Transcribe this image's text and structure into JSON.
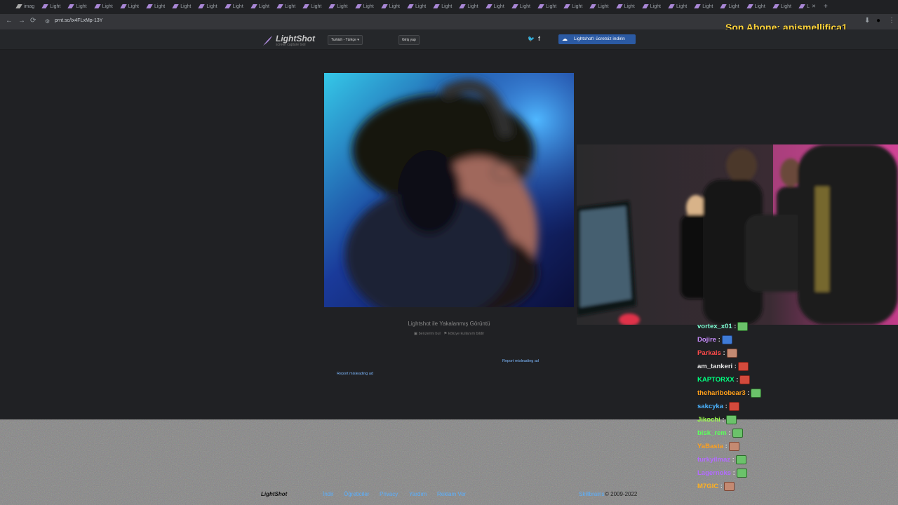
{
  "browser": {
    "tabs": [
      "imag",
      "Light",
      "Light",
      "Light",
      "Light",
      "Light",
      "Light",
      "Light",
      "Light",
      "Light",
      "Light",
      "Light",
      "Light",
      "Light",
      "Light",
      "Light",
      "Light",
      "Light",
      "Light",
      "Light",
      "Light",
      "Light",
      "Light",
      "Light",
      "Light",
      "Light",
      "Light",
      "Light",
      "Light",
      "Light",
      "L"
    ],
    "url": "prnt.sc/Ix4FLxMp-13Y",
    "new_tab_label": "+",
    "close_tab_label": "✕"
  },
  "overlay": {
    "top_right": "Son Abone: apismellifica1"
  },
  "lightshot": {
    "logo": "LightShot",
    "logo_sub": "screen capture tool",
    "language": "Turkish - Türkçe",
    "login": "Giriş yap",
    "download": "Lightshot'ı ücretsiz indirin",
    "caption": "Lightshot ile Yakalanmış Görüntü",
    "similar": "benzerini bul",
    "report": "kötüye kullanım bildir",
    "ad1": "Report misleading ad",
    "ad2": "Report misleading ad"
  },
  "footer": {
    "logo": "LightShot",
    "links": [
      "İndir",
      "Öğreticiler",
      "Privacy",
      "Yardım",
      "Reklam Ver"
    ],
    "brand": "Skillbrains",
    "copyright": "© 2009-2022"
  },
  "chat": [
    {
      "user": "vortex_x01",
      "color": "#7fffd4",
      "emote": "green"
    },
    {
      "user": "Dojire",
      "color": "#c58af9",
      "emote": "blue"
    },
    {
      "user": "Parkals",
      "color": "#ff4a4a",
      "emote": "skin"
    },
    {
      "user": "am_tankeri",
      "color": "#e8e8e8",
      "emote": "red"
    },
    {
      "user": "KAPTORXX",
      "color": "#00ff7f",
      "emote": "red"
    },
    {
      "user": "theharibobear3",
      "color": "#ff9f1a",
      "emote": "green"
    },
    {
      "user": "sakcyka",
      "color": "#4ab3ff",
      "emote": "red"
    },
    {
      "user": "Jikochi",
      "color": "#9aff4a",
      "emote": "green"
    },
    {
      "user": "bisk_rem",
      "color": "#5cff5c",
      "emote": "green"
    },
    {
      "user": "YaBasta",
      "color": "#ff9f1a",
      "emote": "skin"
    },
    {
      "user": "turkyilmaz",
      "color": "#b36bff",
      "emote": "green"
    },
    {
      "user": "Lagernoks",
      "color": "#b36bff",
      "emote": "green"
    },
    {
      "user": "M7GIC",
      "color": "#ffb020",
      "emote": "skin"
    }
  ]
}
